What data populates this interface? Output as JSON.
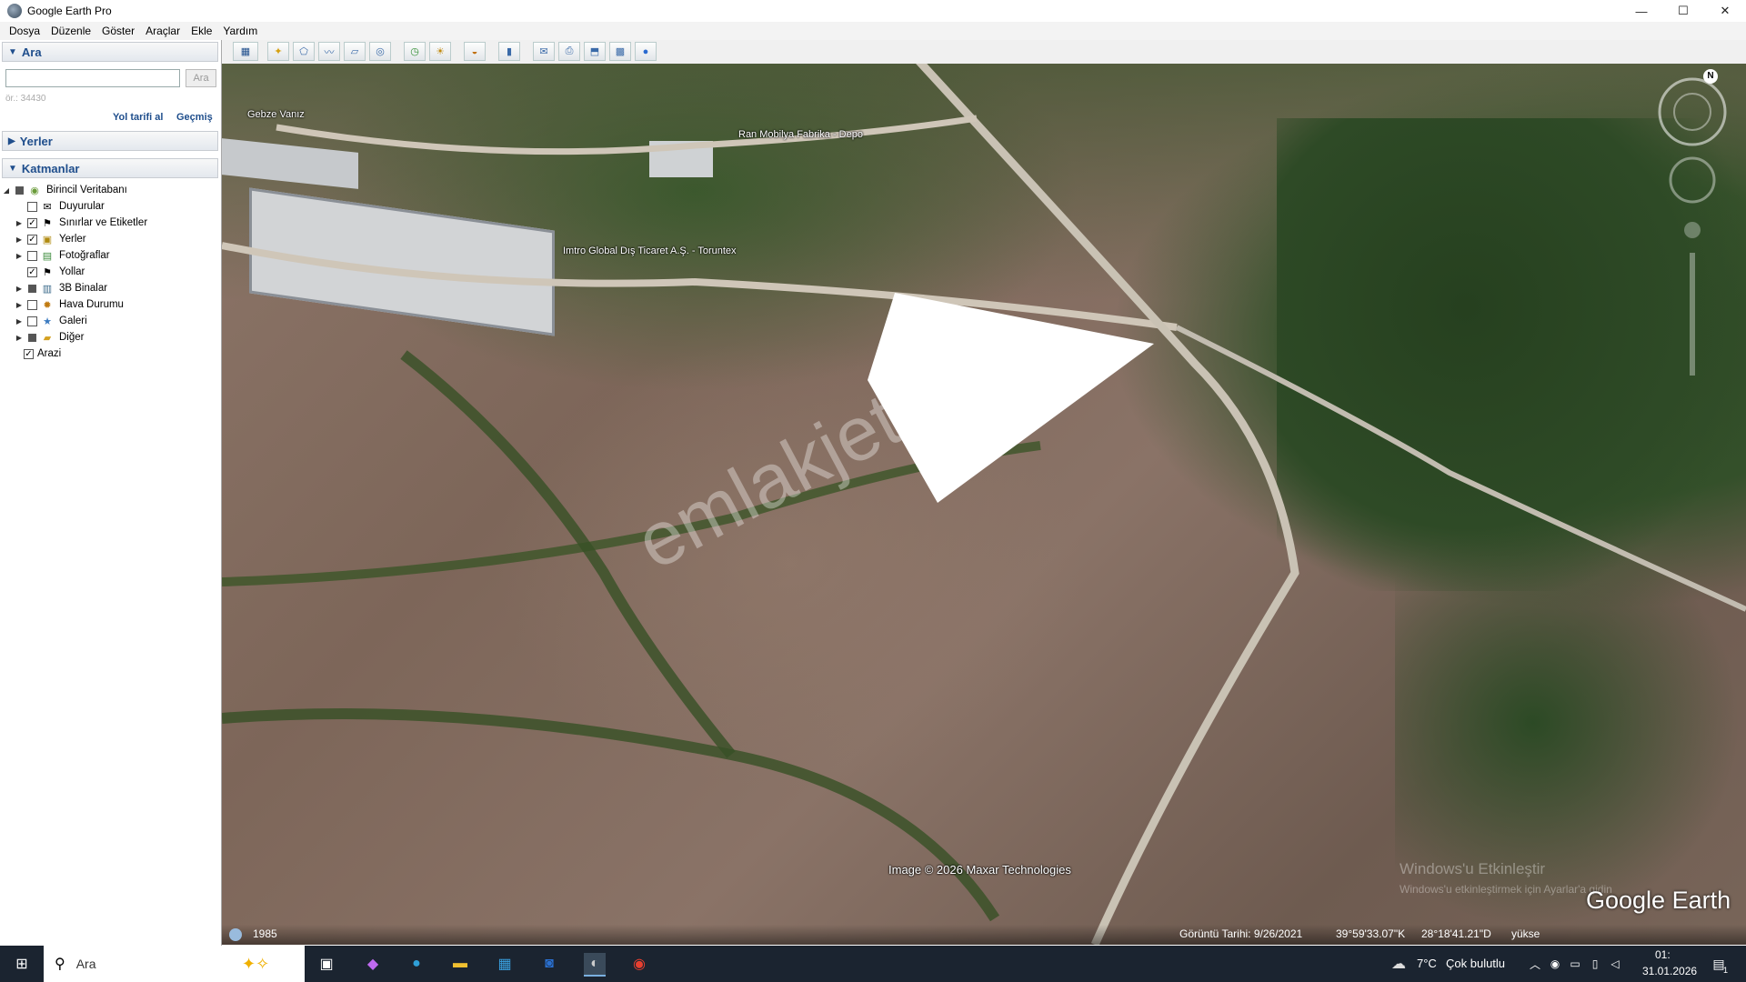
{
  "window": {
    "title": "Google Earth Pro",
    "controls": [
      "—",
      "☐",
      "✕"
    ]
  },
  "menu": [
    "Dosya",
    "Düzenle",
    "Göster",
    "Araçlar",
    "Ekle",
    "Yardım"
  ],
  "search": {
    "header": "Ara",
    "input_value": "",
    "button_label": "Ara",
    "hint": "ör.: 34430",
    "directions_link": "Yol tarifi al",
    "history_link": "Geçmiş"
  },
  "places": {
    "header": "Yerler"
  },
  "layers": {
    "header": "Katmanlar",
    "items": [
      {
        "label": "Birincil Veritabanı",
        "checked": "partial",
        "icon": "globe-layers-icon"
      },
      {
        "label": "Duyurular",
        "checked": false,
        "icon": "envelope-icon"
      },
      {
        "label": "Sınırlar ve Etiketler",
        "checked": true,
        "icon": "flag-icon"
      },
      {
        "label": "Yerler",
        "checked": true,
        "icon": "places-icon"
      },
      {
        "label": "Fotoğraflar",
        "checked": false,
        "icon": "photo-icon"
      },
      {
        "label": "Yollar",
        "checked": true,
        "icon": "road-sign-icon"
      },
      {
        "label": "3B Binalar",
        "checked": "partial",
        "icon": "building-icon"
      },
      {
        "label": "Hava Durumu",
        "checked": false,
        "icon": "sun-icon"
      },
      {
        "label": "Galeri",
        "checked": false,
        "icon": "star-icon"
      },
      {
        "label": "Diğer",
        "checked": "partial",
        "icon": "folder-icon"
      },
      {
        "label": "Arazi",
        "checked": true,
        "icon": ""
      }
    ]
  },
  "toolbar": {
    "buttons": [
      "sidebar-toggle-icon",
      "placemark-icon",
      "polygon-icon",
      "path-icon",
      "image-overlay-icon",
      "record-tour-icon",
      "historical-imagery-icon",
      "sunlight-icon",
      "planets-icon",
      "ruler-icon",
      "email-icon",
      "print-icon",
      "save-image-icon",
      "map-view-icon",
      "google-maps-icon"
    ]
  },
  "map": {
    "labels": {
      "place_1": "Gebze Vanız",
      "place_2": "Ran Mobilya Fabrika - Depo",
      "place_3": "Imtro Global Dış Ticaret A.Ş. - Toruntex"
    },
    "watermark": "emlakjet.com",
    "imagery_credit": "Image © 2026 Maxar Technologies",
    "logo": "Google Earth",
    "windows_activation_title": "Windows'u Etkinleştir",
    "windows_activation_sub": "Windows'u etkinleştirmek için Ayarlar'a gidin",
    "compass_north": "N"
  },
  "status": {
    "year": "1985",
    "image_date": "Görüntü Tarihi: 9/26/2021",
    "lat": "39°59'33.07\"K",
    "lon": "28°18'41.21\"D",
    "elev": "yükse"
  },
  "taskbar": {
    "search_placeholder": "Ara",
    "weather_temp": "7°C",
    "weather_desc": "Çok bulutlu",
    "time": "01:",
    "date": "31.01.2026",
    "notification_count": "1"
  },
  "colors": {
    "accent": "#1f4e8c",
    "taskbar": "#1b2430",
    "polygon": "#ffffff"
  }
}
